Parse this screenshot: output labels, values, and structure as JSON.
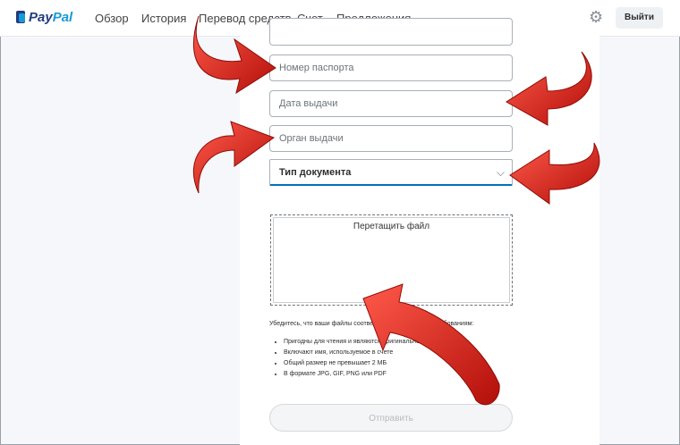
{
  "header": {
    "logo_a": "Pay",
    "logo_b": "Pal",
    "nav": [
      "Обзор",
      "История",
      "Перевод средств",
      "Счет",
      "Предложения"
    ],
    "logout_label": "Выйти",
    "settings_icon": "gear-icon"
  },
  "form": {
    "passport_number_placeholder": "Номер паспорта",
    "issue_date_placeholder": "Дата выдачи",
    "issuer_placeholder": "Орган выдачи",
    "document_type_label": "Тип документа",
    "dropzone_label": "Перетащить файл",
    "requirements_intro": "Убедитесь, что ваши файлы соответствуют следующим требованиям:",
    "requirements": [
      "Пригодны для чтения и являются оригинальной версией",
      "Включают имя, используемое в счете",
      "Общий размер не превышает 2 МБ",
      "В формате JPG, GIF, PNG или PDF"
    ],
    "submit_label": "Отправить"
  },
  "colors": {
    "accent": "#0070ba",
    "arrow": "#e3201b"
  }
}
